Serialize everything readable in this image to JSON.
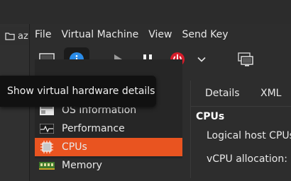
{
  "host": {
    "tab_label": "az",
    "tab_icon": "folder-icon"
  },
  "menubar": {
    "items": [
      "File",
      "Virtual Machine",
      "View",
      "Send Key"
    ]
  },
  "toolbar": {
    "buttons": [
      {
        "name": "console-view-button",
        "icon": "monitor-icon"
      },
      {
        "name": "hardware-details-button",
        "icon": "info-icon",
        "active": true
      },
      {
        "name": "run-button",
        "icon": "play-icon"
      },
      {
        "name": "pause-button",
        "icon": "pause-icon"
      },
      {
        "name": "shutdown-button",
        "icon": "power-icon"
      },
      {
        "name": "shutdown-menu-button",
        "icon": "chevron-down-icon"
      },
      {
        "name": "snapshots-button",
        "icon": "snapshot-icon"
      }
    ],
    "colors": {
      "info": "#2a8be8",
      "power": "#d51c2a"
    }
  },
  "tooltip": {
    "text": "Show virtual hardware details"
  },
  "hardware_list": {
    "items": [
      {
        "label": "OS information",
        "icon": "os-info-icon"
      },
      {
        "label": "Performance",
        "icon": "performance-icon"
      },
      {
        "label": "CPUs",
        "icon": "cpu-icon",
        "selected": true
      },
      {
        "label": "Memory",
        "icon": "memory-icon"
      }
    ],
    "selected_color": "#e95420"
  },
  "details": {
    "tabs": [
      "Details",
      "XML"
    ],
    "section_title": "CPUs",
    "fields": [
      "Logical host CPUs:",
      "vCPU allocation:"
    ]
  }
}
